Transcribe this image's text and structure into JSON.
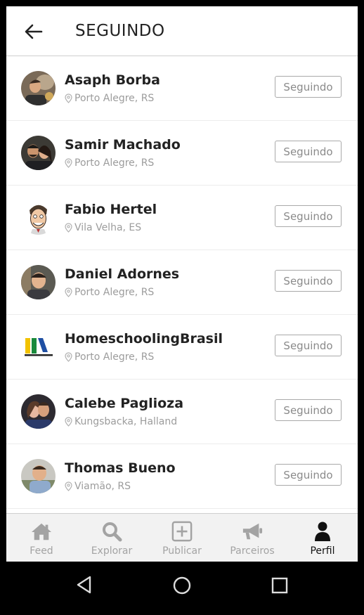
{
  "header": {
    "title": "SEGUINDO",
    "back_icon": "arrow-left-icon"
  },
  "list": {
    "items": [
      {
        "name": "Asaph Borba",
        "location": "Porto Alegre, RS",
        "button": "Seguindo"
      },
      {
        "name": "Samir Machado",
        "location": "Porto Alegre, RS",
        "button": "Seguindo"
      },
      {
        "name": "Fabio Hertel",
        "location": "Vila Velha, ES",
        "button": "Seguindo"
      },
      {
        "name": "Daniel Adornes",
        "location": "Porto Alegre, RS",
        "button": "Seguindo"
      },
      {
        "name": "HomeschoolingBrasil",
        "location": "Porto Alegre, RS",
        "button": "Seguindo"
      },
      {
        "name": "Calebe Paglioza",
        "location": "Kungsbacka, Halland",
        "button": "Seguindo"
      },
      {
        "name": "Thomas Bueno",
        "location": "Viamão, RS",
        "button": "Seguindo"
      }
    ]
  },
  "nav": {
    "items": [
      {
        "label": "Feed",
        "icon": "home-icon",
        "active": false
      },
      {
        "label": "Explorar",
        "icon": "search-icon",
        "active": false
      },
      {
        "label": "Publicar",
        "icon": "plus-square-icon",
        "active": false
      },
      {
        "label": "Parceiros",
        "icon": "megaphone-icon",
        "active": false
      },
      {
        "label": "Perfil",
        "icon": "person-icon",
        "active": true
      }
    ]
  },
  "colors": {
    "text_primary": "#222222",
    "text_secondary": "#9c9c9c",
    "button_border": "#a9a9a9",
    "nav_inactive": "#a3a3a3",
    "nav_active": "#111111",
    "nav_background": "#f2f2f2"
  }
}
